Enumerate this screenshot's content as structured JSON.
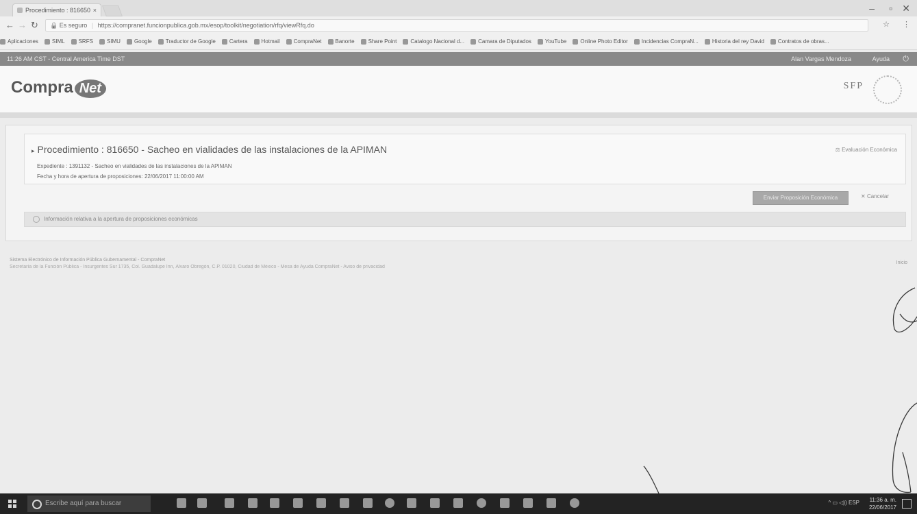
{
  "browser": {
    "tab_title": "Procedimiento : 816650",
    "tab_close": "×",
    "url_secure": "Es seguro",
    "url": "https://compranet.funcionpublica.gob.mx/esop/toolkit/negotiation/rfq/viewRfq.do",
    "bookmarks": [
      "Aplicaciones",
      "SIML",
      "SRFS",
      "SIMU",
      "Google",
      "Traductor de Google",
      "Cartera",
      "Hotmail",
      "CompraNet",
      "Banorte",
      "Share Point",
      "Catalogo Nacional d...",
      "Camara de Diputados",
      "YouTube",
      "Online Photo Editor",
      "Incidencias CompraN...",
      "Historia del rey David",
      "Contratos de obras..."
    ]
  },
  "site_bar": {
    "timezone": "11:26 AM CST - Central America Time DST",
    "user": "Alan Vargas Mendoza",
    "help": "Ayuda",
    "logout_icon": "power-icon"
  },
  "header": {
    "logo_text": "Compra",
    "logo_net": "Net",
    "sfp": "SFP"
  },
  "procedure": {
    "title": "Procedimiento : 816650 - Sacheo en vialidades de las instalaciones de la APIMAN",
    "expediente": "Expediente : 1391132 - Sacheo en vialidades de las instalaciones de la APIMAN",
    "fecha": "Fecha y hora de apertura de proposiciones: 22/06/2017 11:00:00 AM",
    "eval_button": "Evaluación Económica",
    "send_button": "Enviar Proposición Económica",
    "cancel_button": "Cancelar",
    "info": "Información relativa a la apertura de proposiciones económicas"
  },
  "footer": {
    "line1": "Sistema Electrónico de Información Pública Gubernamental - CompraNet",
    "line2": "Secretaría de la Función Pública - Insurgentes Sur 1735, Col. Guadalupe Inn, Álvaro Obregón, C.P. 01020, Ciudad de México - Mesa de Ayuda CompraNet - Aviso de privacidad",
    "right": "Inicio"
  },
  "taskbar": {
    "search_placeholder": "Escribe aquí para buscar",
    "time": "11:36 a. m.",
    "date": "22/06/2017",
    "lang": "ESP"
  }
}
